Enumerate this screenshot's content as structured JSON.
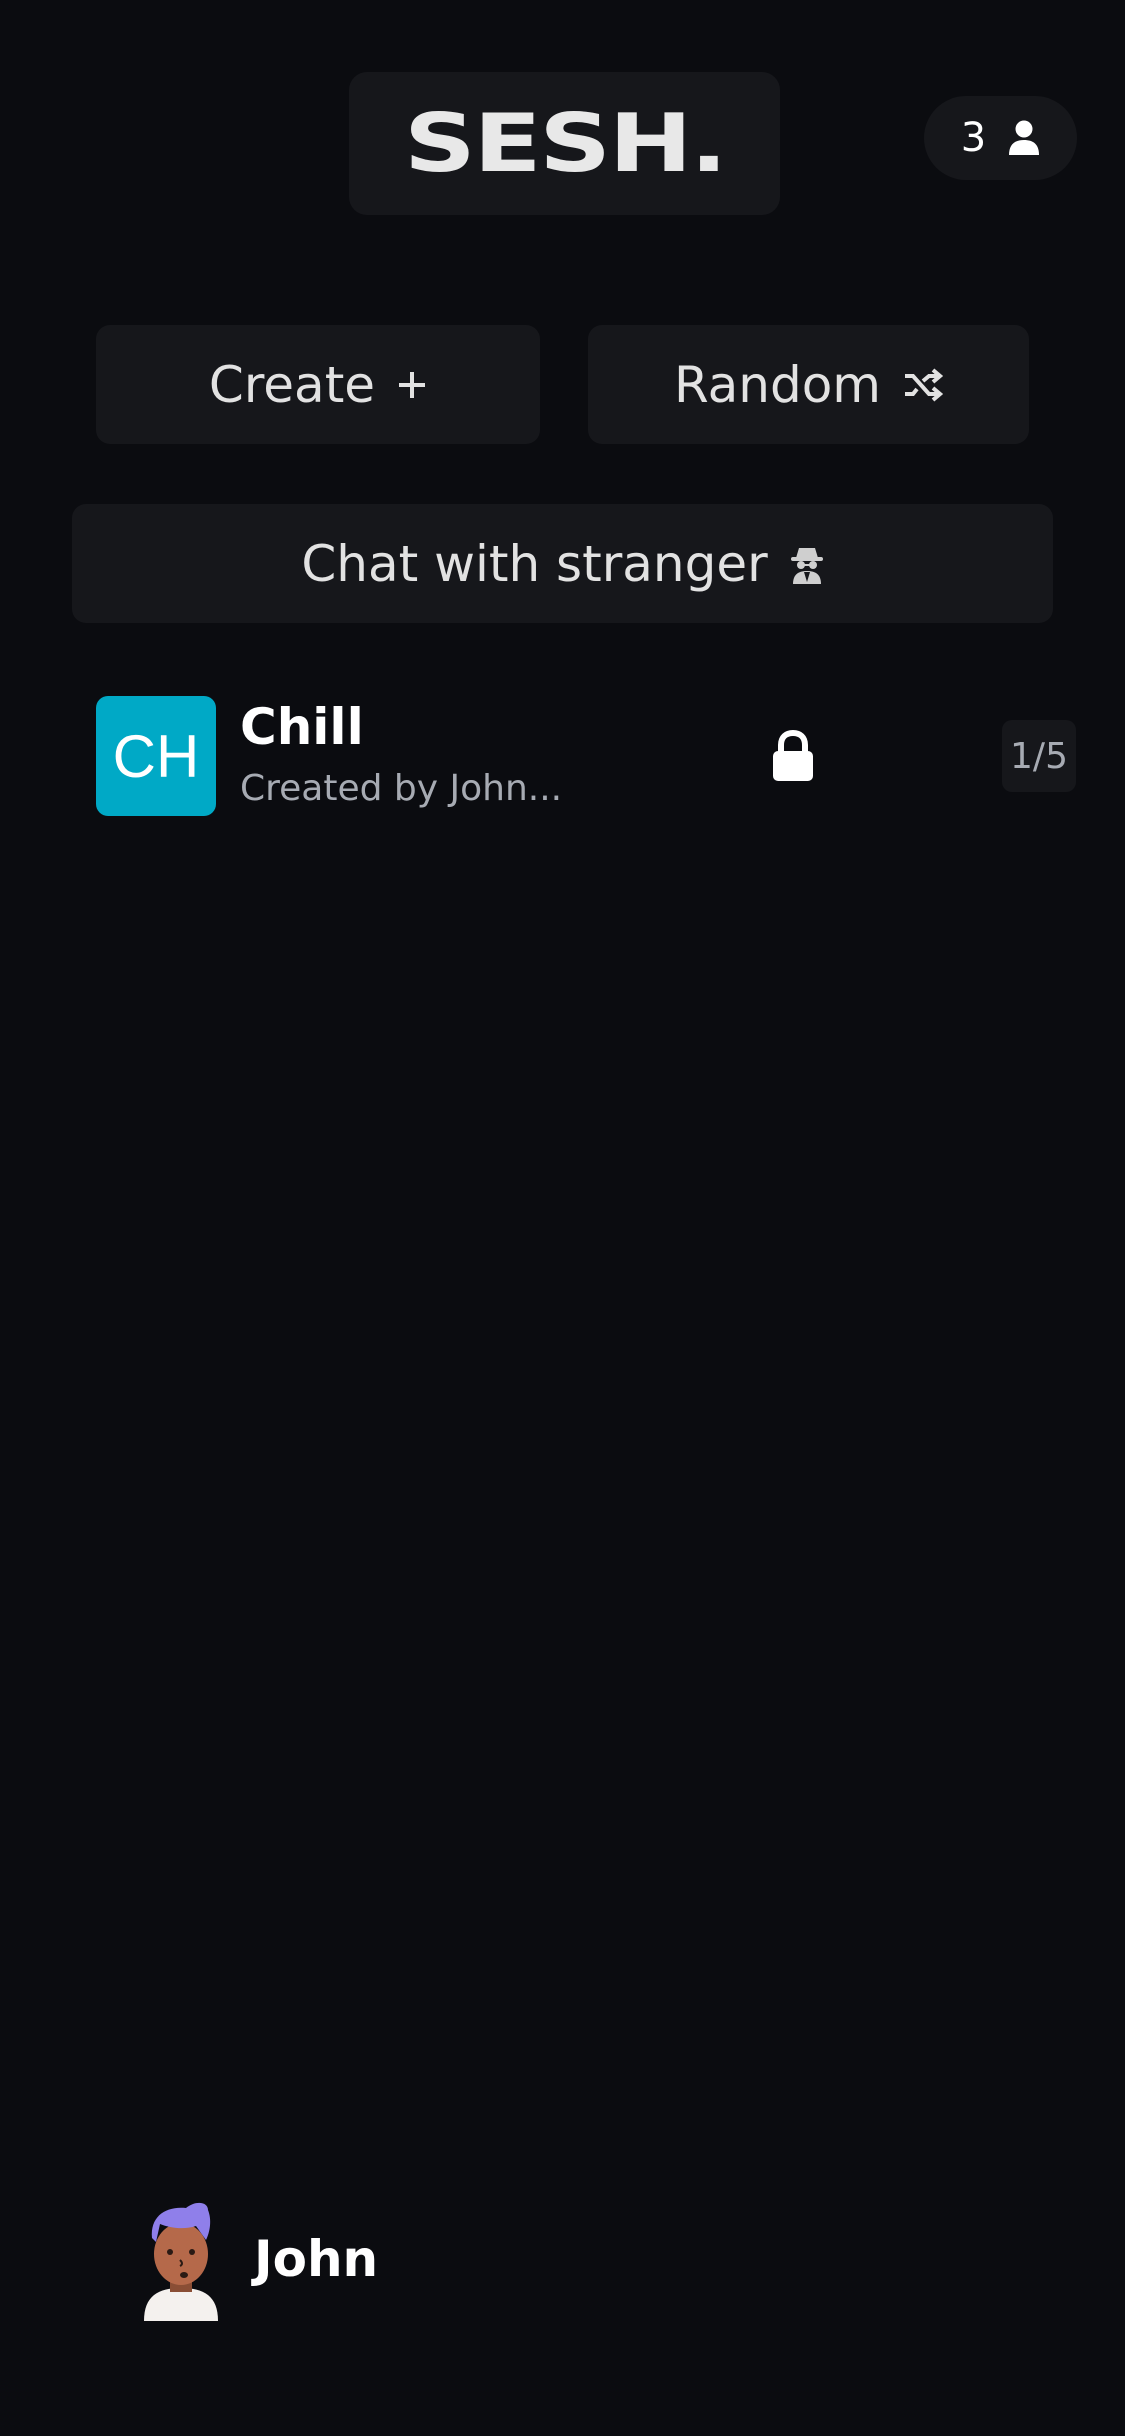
{
  "header": {
    "logo_text": "SESH.",
    "online_count": "3",
    "online_icon": "user-icon"
  },
  "actions": {
    "create_label": "Create",
    "create_icon": "plus-icon",
    "random_label": "Random",
    "random_icon": "shuffle-icon",
    "stranger_label": "Chat with stranger",
    "stranger_icon": "spy-icon"
  },
  "rooms": [
    {
      "initials": "CH",
      "name": "Chill",
      "creator": "Created by John...",
      "locked": true,
      "lock_icon": "lock-icon",
      "capacity": "1/5",
      "avatar_color": "#00a9c6"
    }
  ],
  "profile": {
    "name": "John",
    "avatar_icon": "user-avatar-illustration"
  },
  "colors": {
    "background": "#0b0c10",
    "surface": "#16171b",
    "accent": "#00a9c6",
    "muted_text": "#a7abb3"
  }
}
